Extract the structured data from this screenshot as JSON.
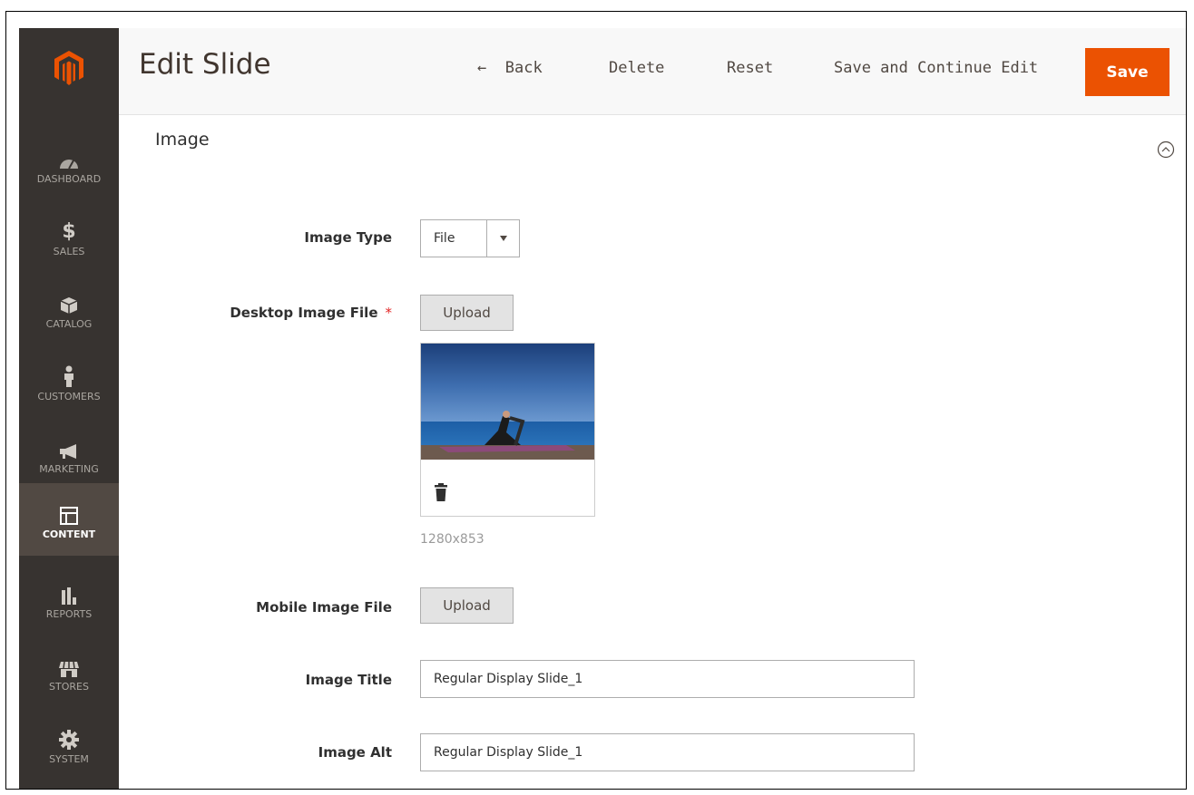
{
  "header": {
    "title": "Edit Slide",
    "back_label": "Back",
    "delete_label": "Delete",
    "reset_label": "Reset",
    "save_continue_label": "Save and Continue Edit",
    "save_label": "Save"
  },
  "sidebar": {
    "items": [
      {
        "label": "DASHBOARD",
        "icon": "dashboard-icon"
      },
      {
        "label": "SALES",
        "icon": "dollar-icon"
      },
      {
        "label": "CATALOG",
        "icon": "box-icon"
      },
      {
        "label": "CUSTOMERS",
        "icon": "person-icon"
      },
      {
        "label": "MARKETING",
        "icon": "megaphone-icon"
      },
      {
        "label": "CONTENT",
        "icon": "layout-icon",
        "active": true
      },
      {
        "label": "REPORTS",
        "icon": "bar-chart-icon"
      },
      {
        "label": "STORES",
        "icon": "storefront-icon"
      },
      {
        "label": "SYSTEM",
        "icon": "gear-icon"
      }
    ]
  },
  "section": {
    "title": "Image"
  },
  "form": {
    "image_type_label": "Image Type",
    "image_type_value": "File",
    "desktop_label": "Desktop Image File",
    "required_mark": "*",
    "upload_label": "Upload",
    "image_dimensions": "1280x853",
    "mobile_label": "Mobile Image File",
    "title_label": "Image Title",
    "title_value": "Regular Display Slide_1",
    "alt_label": "Image Alt",
    "alt_value": "Regular Display Slide_1"
  },
  "colors": {
    "sidebar_bg": "#373330",
    "sidebar_active": "#514943",
    "save_button": "#eb5202",
    "logo": "#eb5202"
  }
}
